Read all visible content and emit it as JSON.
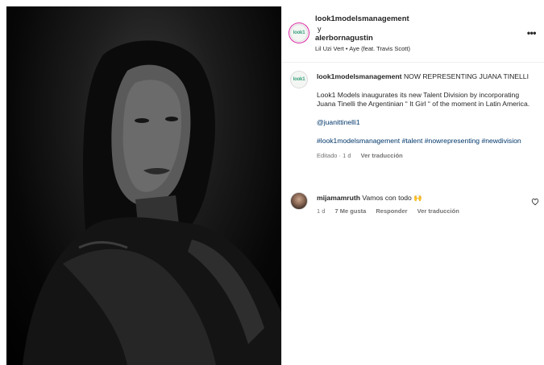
{
  "header": {
    "avatar_text": "look1",
    "account1": "look1modelsmanagement",
    "conjunction": "y",
    "account2": "alerbornagustin",
    "song": "Lil Uzi Vert • Aye (feat. Travis Scott)",
    "more_icon": "more-horizontal-icon"
  },
  "caption": {
    "avatar_text": "look1",
    "username": "look1modelsmanagement",
    "title": "NOW REPRESENTING JUANA TINELLI",
    "body": "Look1 Models inaugurates its new Talent Division by incorporating Juana Tinelli the Argentinian “ It Girl “ of the moment in Latin America.",
    "mention": "@juanittinelli1",
    "hashtags": "#look1modelsmanagement #talent #nowrepresenting #newdivision",
    "edited": "Editado · 1 d",
    "translate": "Ver traducción"
  },
  "comment": {
    "username": "mijamamruth",
    "text": "Vamos con todo 🙌",
    "time": "1 d",
    "likes": "7 Me gusta",
    "reply": "Responder",
    "translate": "Ver traducción",
    "like_icon": "heart-icon"
  }
}
